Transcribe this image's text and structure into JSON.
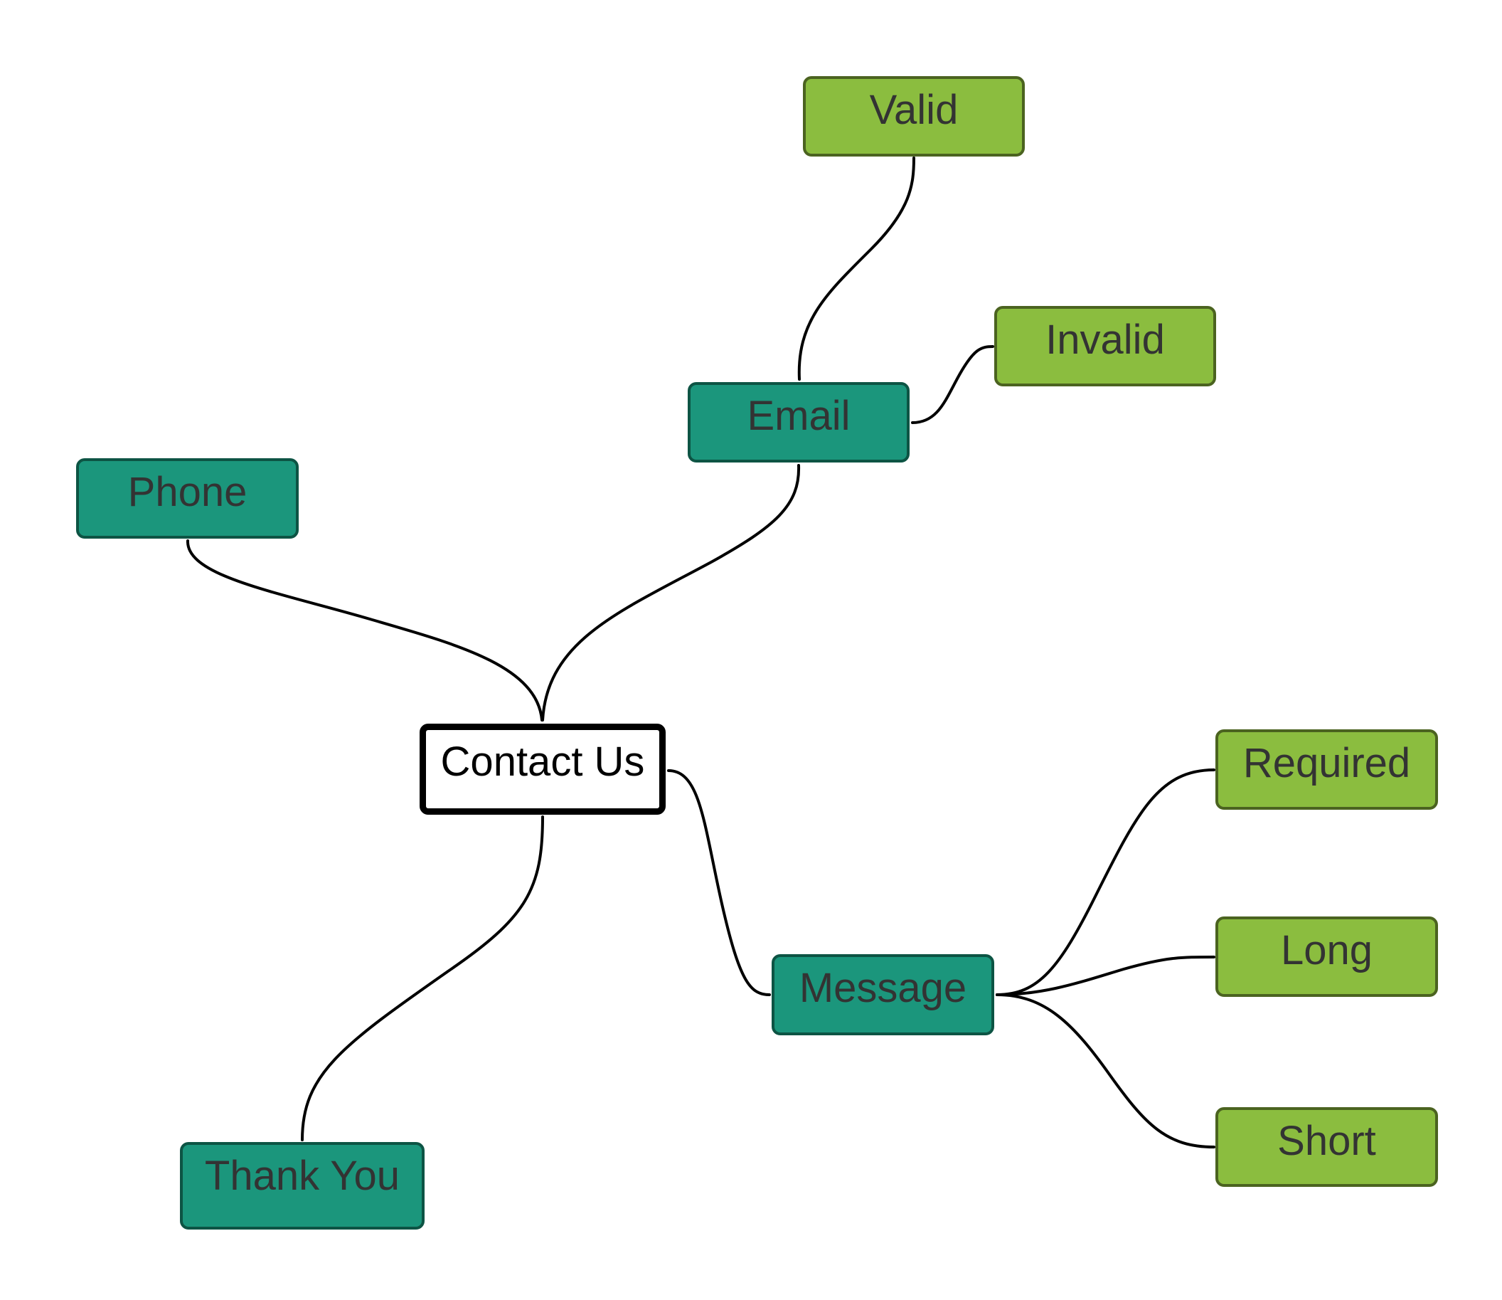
{
  "diagram": {
    "type": "mind-map",
    "colors": {
      "root_fill": "#ffffff",
      "root_border": "#000000",
      "topic_fill": "#1b967c",
      "topic_border": "#0d5444",
      "subtopic_fill": "#8bbd3f",
      "subtopic_border": "#4b6320",
      "text": "#333333",
      "edge": "#000000"
    },
    "root": {
      "id": "contact-us",
      "label": "Contact Us"
    },
    "nodes": [
      {
        "id": "phone",
        "label": "Phone",
        "level": "topic",
        "parent": "contact-us"
      },
      {
        "id": "email",
        "label": "Email",
        "level": "topic",
        "parent": "contact-us"
      },
      {
        "id": "message",
        "label": "Message",
        "level": "topic",
        "parent": "contact-us"
      },
      {
        "id": "thank-you",
        "label": "Thank You",
        "level": "topic",
        "parent": "contact-us"
      },
      {
        "id": "valid",
        "label": "Valid",
        "level": "subtopic",
        "parent": "email"
      },
      {
        "id": "invalid",
        "label": "Invalid",
        "level": "subtopic",
        "parent": "email"
      },
      {
        "id": "required",
        "label": "Required",
        "level": "subtopic",
        "parent": "message"
      },
      {
        "id": "long",
        "label": "Long",
        "level": "subtopic",
        "parent": "message"
      },
      {
        "id": "short",
        "label": "Short",
        "level": "subtopic",
        "parent": "message"
      }
    ]
  }
}
